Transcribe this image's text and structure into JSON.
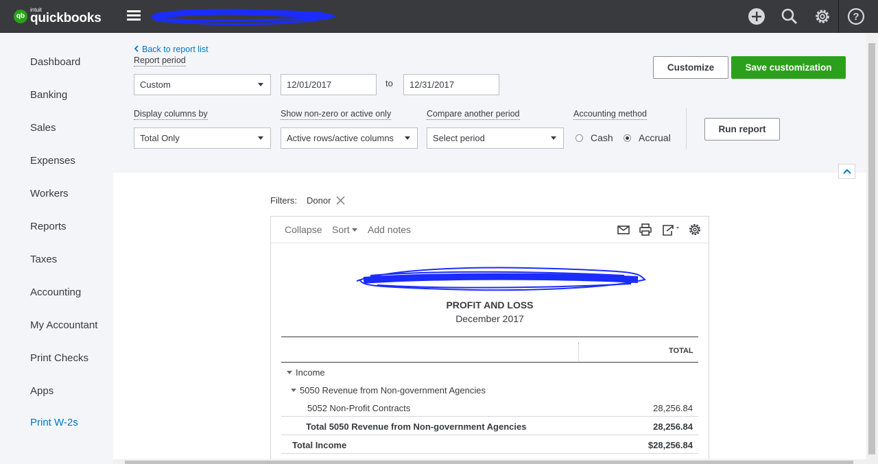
{
  "topbar": {
    "logo_intuit": "intuit",
    "logo_name": "quickbooks",
    "logo_badge": "qb",
    "icons": [
      "menu-icon",
      "add-icon",
      "search-icon",
      "gear-icon",
      "help-icon"
    ],
    "colors": {
      "bar": "#393a3d",
      "brand_green": "#2ca01c"
    }
  },
  "sidebar": {
    "items": [
      {
        "label": "Dashboard"
      },
      {
        "label": "Banking"
      },
      {
        "label": "Sales"
      },
      {
        "label": "Expenses"
      },
      {
        "label": "Workers"
      },
      {
        "label": "Reports"
      },
      {
        "label": "Taxes"
      },
      {
        "label": "Accounting"
      },
      {
        "label": "My Accountant"
      },
      {
        "label": "Print Checks"
      },
      {
        "label": "Apps"
      },
      {
        "label": "Print W-2s"
      }
    ]
  },
  "controls": {
    "back_link": "Back to report list",
    "report_period_label": "Report period",
    "report_period_value": "Custom",
    "start_date": "12/01/2017",
    "to_label": "to",
    "end_date": "12/31/2017",
    "customize_label": "Customize",
    "save_label": "Save customization",
    "display_columns_label": "Display columns by",
    "display_columns_value": "Total Only",
    "show_nonzero_label": "Show non-zero or active only",
    "show_nonzero_value": "Active rows/active columns",
    "compare_label": "Compare another period",
    "compare_placeholder": "Select period",
    "accounting_method_label": "Accounting method",
    "cash_label": "Cash",
    "accrual_label": "Accrual",
    "selected_method": "Accrual",
    "run_report_label": "Run report"
  },
  "report": {
    "filters_label": "Filters:",
    "filter_value": "Donor",
    "toolbar": {
      "collapse": "Collapse",
      "sort": "Sort",
      "add_notes": "Add notes"
    },
    "title": "PROFIT AND LOSS",
    "subtitle": "December 2017",
    "column_header": "TOTAL",
    "rows": [
      {
        "label": "Income",
        "value": ""
      },
      {
        "label": "5050 Revenue from Non-government Agencies",
        "value": ""
      },
      {
        "label": "5052 Non-Profit Contracts",
        "value": "28,256.84"
      },
      {
        "label": "Total 5050 Revenue from Non-government Agencies",
        "value": "28,256.84"
      },
      {
        "label": "Total Income",
        "value": "$28,256.84"
      }
    ]
  }
}
